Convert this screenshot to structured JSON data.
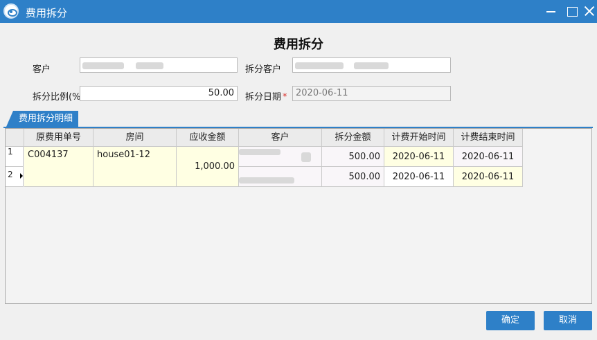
{
  "window": {
    "title": "费用拆分"
  },
  "dialog": {
    "heading": "费用拆分"
  },
  "form": {
    "customer_label": "客户",
    "split_customer_label": "拆分客户",
    "ratio_label": "拆分比例(%",
    "ratio_value": "50.00",
    "date_label": "拆分日期",
    "date_value": "2020-06-11"
  },
  "tab": {
    "label": "费用拆分明细"
  },
  "table": {
    "headers": [
      "原费用单号",
      "房间",
      "应收金额",
      "客户",
      "拆分金额",
      "计费开始时间",
      "计费结束时间"
    ],
    "row_numbers": [
      "1",
      "2"
    ],
    "shared": {
      "original_no": "C004137",
      "room": "house01-12",
      "receivable": "1,000.00"
    },
    "rows": [
      {
        "split_amount": "500.00",
        "start": "2020-06-11",
        "end": "2020-06-11"
      },
      {
        "split_amount": "500.00",
        "start": "2020-06-11",
        "end": "2020-06-11"
      }
    ]
  },
  "buttons": {
    "ok": "确定",
    "cancel": "取消"
  }
}
